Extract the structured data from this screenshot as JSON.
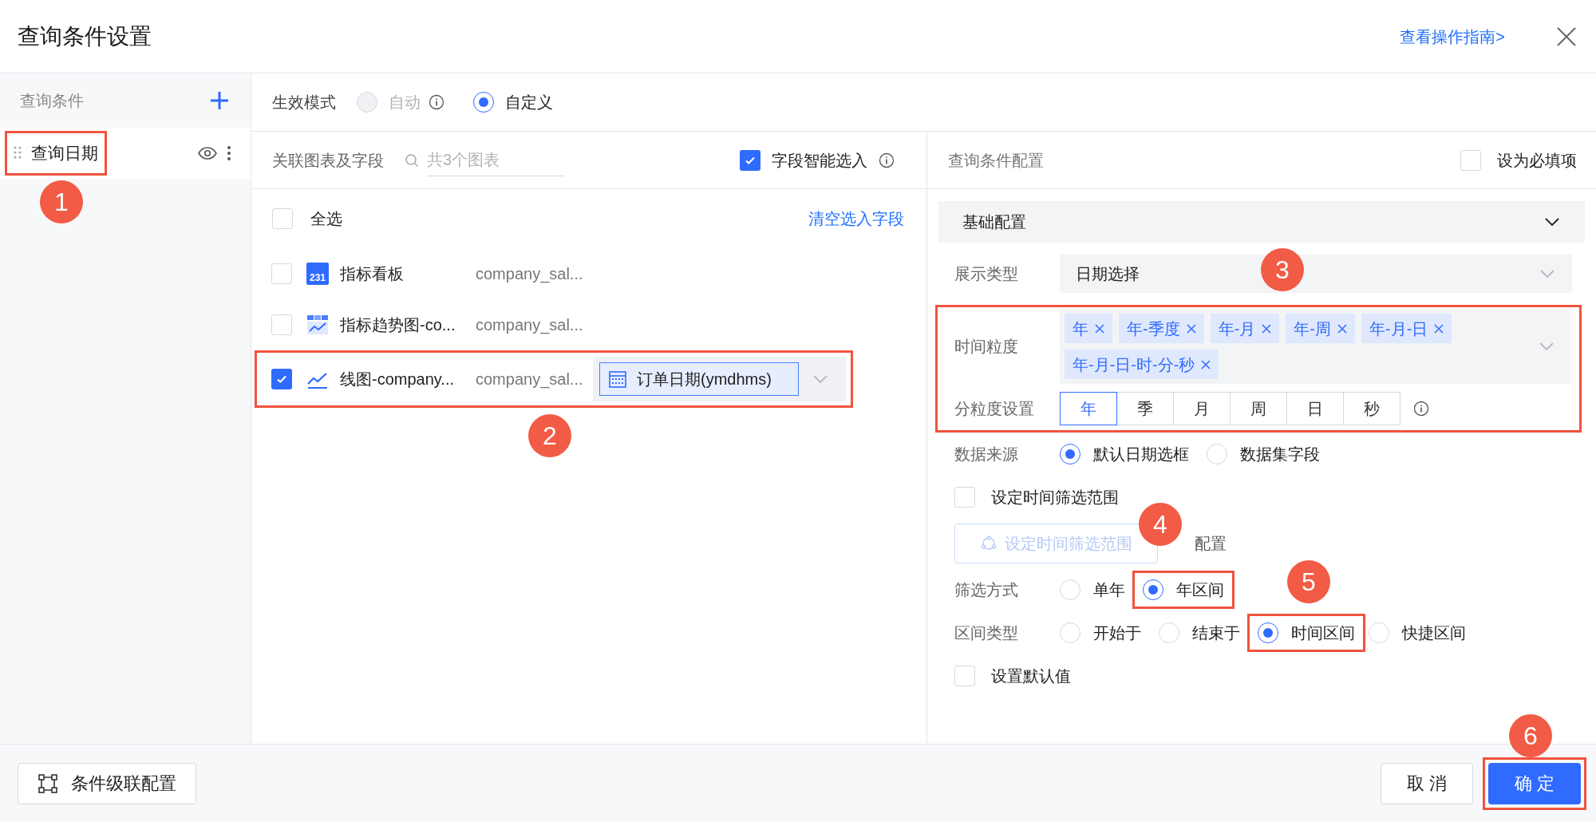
{
  "dialog": {
    "title": "查询条件设置",
    "guide_link": "查看操作指南>"
  },
  "sidebar": {
    "heading": "查询条件",
    "items": [
      {
        "label": "查询日期",
        "selected": true
      }
    ]
  },
  "mode": {
    "label": "生效模式",
    "options": [
      {
        "label": "自动",
        "selected": false,
        "disabled": true
      },
      {
        "label": "自定义",
        "selected": true,
        "disabled": false
      }
    ]
  },
  "linked": {
    "label": "关联图表及字段",
    "search_placeholder": "共3个图表",
    "smart_select": {
      "label": "字段智能选入",
      "checked": true
    },
    "select_all": {
      "label": "全选",
      "checked": false
    },
    "clear_link": "清空选入字段",
    "rows": [
      {
        "kind": "kpi",
        "icon_text": "231",
        "name": "指标看板",
        "dataset": "company_sal...",
        "checked": false
      },
      {
        "kind": "trend",
        "name": "指标趋势图-co...",
        "dataset": "company_sal...",
        "checked": false
      },
      {
        "kind": "line",
        "name": "线图-company...",
        "dataset": "company_sal...",
        "checked": true,
        "field": "订单日期(ymdhms)"
      }
    ]
  },
  "config": {
    "title": "查询条件配置",
    "required": {
      "label": "设为必填项",
      "checked": false
    },
    "section": {
      "title": "基础配置",
      "expanded": true
    },
    "display_type": {
      "label": "展示类型",
      "value": "日期选择"
    },
    "granularity": {
      "label": "时间粒度",
      "tags": [
        "年",
        "年-季度",
        "年-月",
        "年-周",
        "年-月-日",
        "年-月-日-时-分-秒"
      ]
    },
    "sub_granularity": {
      "label": "分粒度设置",
      "options": [
        {
          "label": "年",
          "selected": true
        },
        {
          "label": "季",
          "selected": false
        },
        {
          "label": "月",
          "selected": false
        },
        {
          "label": "周",
          "selected": false
        },
        {
          "label": "日",
          "selected": false
        },
        {
          "label": "秒",
          "selected": false
        }
      ]
    },
    "data_source": {
      "label": "数据来源",
      "options": [
        {
          "label": "默认日期选框",
          "selected": true
        },
        {
          "label": "数据集字段",
          "selected": false
        }
      ]
    },
    "time_range": {
      "label": "设定时间筛选范围",
      "checked": false
    },
    "range_button": {
      "label": "设定时间筛选范围",
      "disabled": true
    },
    "range_note": "配置",
    "filter_mode": {
      "label": "筛选方式",
      "options": [
        {
          "label": "单年",
          "selected": false
        },
        {
          "label": "年区间",
          "selected": true
        }
      ]
    },
    "interval_type": {
      "label": "区间类型",
      "options": [
        {
          "label": "开始于",
          "selected": false
        },
        {
          "label": "结束于",
          "selected": false
        },
        {
          "label": "时间区间",
          "selected": true
        },
        {
          "label": "快捷区间",
          "selected": false
        }
      ]
    },
    "default_value": {
      "label": "设置默认值",
      "checked": false
    }
  },
  "footer": {
    "cascade_button": "条件级联配置",
    "cancel": "取 消",
    "ok": "确 定"
  },
  "annotations": [
    {
      "number": "1"
    },
    {
      "number": "2"
    },
    {
      "number": "3"
    },
    {
      "number": "4"
    },
    {
      "number": "5"
    },
    {
      "number": "6"
    }
  ]
}
